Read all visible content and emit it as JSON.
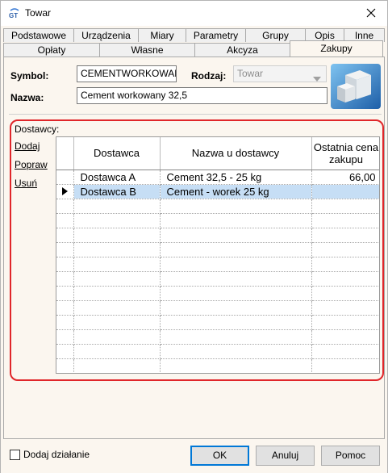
{
  "window": {
    "title": "Towar"
  },
  "tabs_row1": [
    "Podstawowe",
    "Urządzenia",
    "Miary",
    "Parametry",
    "Grupy",
    "Opis",
    "Inne"
  ],
  "tabs_row2": [
    "Opłaty",
    "Własne",
    "Akcyza",
    "Zakupy"
  ],
  "active_tab": "Zakupy",
  "form": {
    "symbol_label": "Symbol:",
    "symbol_value": "CEMENTWORKOWANY",
    "rodzaj_label": "Rodzaj:",
    "rodzaj_value": "Towar",
    "nazwa_label": "Nazwa:",
    "nazwa_value": "Cement workowany 32,5"
  },
  "suppliers": {
    "label": "Dostawcy:",
    "actions": [
      "Dodaj",
      "Popraw",
      "Usuń"
    ],
    "columns": [
      "Dostawca",
      "Nazwa u dostawcy",
      "Ostatnia cena zakupu"
    ],
    "rows": [
      {
        "dostawca": "Dostawca A",
        "nazwa": "Cement 32,5 - 25 kg",
        "cena": "66,00",
        "selected": false
      },
      {
        "dostawca": "Dostawca B",
        "nazwa": "Cement - worek 25 kg",
        "cena": "",
        "selected": true
      }
    ]
  },
  "footer": {
    "checkbox_label": "Dodaj działanie",
    "ok": "OK",
    "cancel": "Anuluj",
    "help": "Pomoc"
  },
  "colors": {
    "highlight_border": "#e0262a",
    "selected_row": "#c6def5"
  }
}
